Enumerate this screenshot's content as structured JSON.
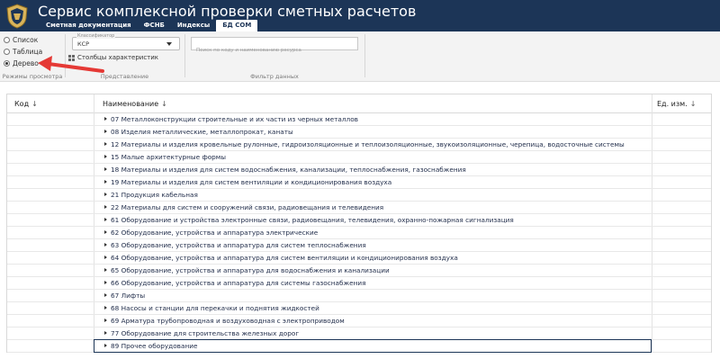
{
  "header": {
    "title": "Сервис комплексной проверки сметных расчетов",
    "tabs": [
      {
        "label": "Сметная документация",
        "active": false
      },
      {
        "label": "ФСНБ",
        "active": false
      },
      {
        "label": "Индексы",
        "active": false
      },
      {
        "label": "БД СОМ",
        "active": true
      }
    ],
    "bg_color": "#1c3557"
  },
  "ribbon": {
    "view_modes": {
      "caption": "Режимы просмотра",
      "options": [
        {
          "label": "Список",
          "checked": false
        },
        {
          "label": "Таблица",
          "checked": false
        },
        {
          "label": "Дерево",
          "checked": true
        }
      ]
    },
    "presentation": {
      "caption": "Представление",
      "classifier_legend": "Классификатор",
      "classifier_value": "КСР",
      "columns_button": "Столбцы характеристик"
    },
    "filter": {
      "caption": "Фильтр данных",
      "search_placeholder": "Поиск по коду и наименованию ресурса"
    }
  },
  "table": {
    "columns": [
      {
        "label": "Код",
        "sort_icon": "arrow-down-icon"
      },
      {
        "label": "Наименование",
        "sort_icon": "arrow-down-icon"
      },
      {
        "label": "Ед. изм.",
        "sort_icon": "arrow-down-icon"
      }
    ],
    "rows": [
      "07 Металлоконструкции строительные и их части из черных металлов",
      "08 Изделия металлические, металлопрокат, канаты",
      "12 Материалы и изделия кровельные рулонные, гидроизоляционные и теплоизоляционные, звукоизоляционные, черепица, водосточные системы",
      "15 Малые архитектурные формы",
      "18 Материалы и изделия для систем водоснабжения, канализации, теплоснабжения, газоснабжения",
      "19 Материалы и изделия для систем вентиляции и кондиционирования воздуха",
      "21 Продукция кабельная",
      "22 Материалы для систем и сооружений связи, радиовещания и телевидения",
      "61 Оборудование и устройства электронные связи, радиовещания, телевидения, охранно-пожарная сигнализация",
      "62 Оборудование, устройства и аппаратура электрические",
      "63 Оборудование, устройства и аппаратура для систем теплоснабжения",
      "64 Оборудование, устройства и аппаратура для систем вентиляции и кондиционирования воздуха",
      "65 Оборудование, устройства и аппаратура для водоснабжения и канализации",
      "66 Оборудование, устройства и аппаратура для системы газоснабжения",
      "67 Лифты",
      "68 Насосы и станции для перекачки и поднятия жидкостей",
      "69 Арматура трубопроводная и воздуховодная с электроприводом",
      "77 Оборудование для строительства железных дорог",
      "89 Прочее оборудование"
    ],
    "selected_row": "89 Прочее оборудование"
  },
  "colors": {
    "annotation_arrow": "#e53935",
    "header": "#1c3557"
  }
}
